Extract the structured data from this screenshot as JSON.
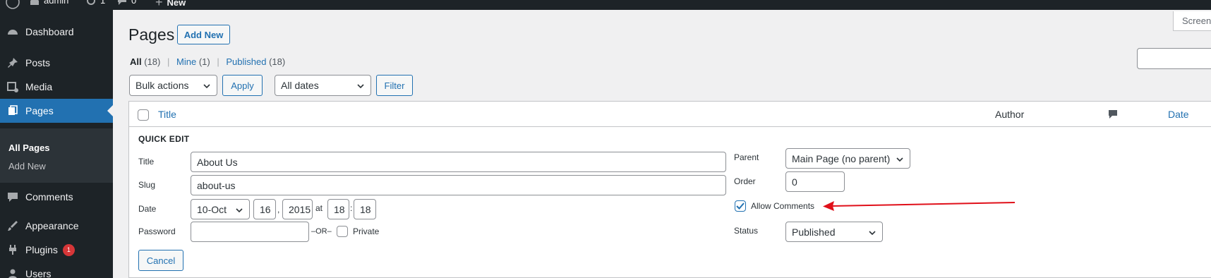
{
  "admin_bar": {
    "site_user": "admin",
    "updates_count": "1",
    "comments_count": "0",
    "new_label": "New"
  },
  "sidebar": {
    "items": [
      {
        "label": "Dashboard",
        "icon": "dashboard-icon"
      },
      {
        "label": "Posts",
        "icon": "pin-icon"
      },
      {
        "label": "Media",
        "icon": "media-icon"
      },
      {
        "label": "Pages",
        "icon": "pages-icon"
      },
      {
        "label": "Comments",
        "icon": "comment-icon"
      },
      {
        "label": "Appearance",
        "icon": "brush-icon"
      },
      {
        "label": "Plugins",
        "icon": "plugin-icon",
        "badge": "1"
      },
      {
        "label": "Users",
        "icon": "user-icon"
      }
    ],
    "submenu": [
      {
        "label": "All Pages"
      },
      {
        "label": "Add New"
      }
    ]
  },
  "header": {
    "title": "Pages",
    "add_new": "Add New",
    "screen_options": "Screen"
  },
  "filters": {
    "all_label": "All",
    "all_count": "(18)",
    "mine_label": "Mine",
    "mine_count": "(1)",
    "published_label": "Published",
    "published_count": "(18)",
    "separator": "|"
  },
  "tablenav": {
    "bulk_actions": "Bulk actions",
    "apply": "Apply",
    "dates": "All dates",
    "filter": "Filter"
  },
  "table": {
    "col_title": "Title",
    "col_author": "Author",
    "col_date": "Date"
  },
  "quick_edit": {
    "heading": "QUICK EDIT",
    "title_label": "Title",
    "title_value": "About Us",
    "slug_label": "Slug",
    "slug_value": "about-us",
    "date_label": "Date",
    "month": "10-Oct",
    "day": "16",
    "comma": ",",
    "year": "2015",
    "at": "at",
    "hour": "18",
    "colon": ":",
    "minute": "18",
    "password_label": "Password",
    "or_label": "–OR–",
    "private_label": "Private",
    "parent_label": "Parent",
    "parent_value": "Main Page (no parent)",
    "order_label": "Order",
    "order_value": "0",
    "allow_comments_label": "Allow Comments",
    "allow_comments_checked": true,
    "status_label": "Status",
    "status_value": "Published",
    "cancel": "Cancel"
  },
  "colors": {
    "accent": "#2271b1",
    "sidebar_bg": "#1d2327",
    "arrow": "#e0101a"
  }
}
